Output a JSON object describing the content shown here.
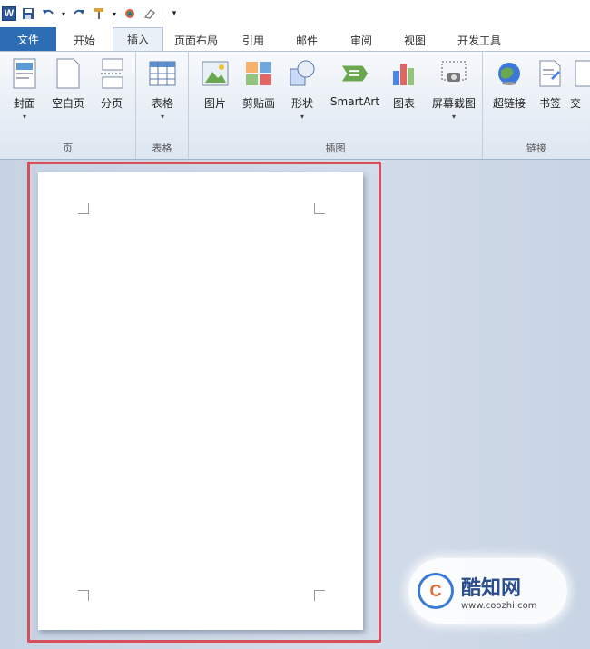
{
  "qat": {
    "app_letter": "W"
  },
  "tabs": [
    {
      "label": "文件"
    },
    {
      "label": "开始"
    },
    {
      "label": "插入"
    },
    {
      "label": "页面布局"
    },
    {
      "label": "引用"
    },
    {
      "label": "邮件"
    },
    {
      "label": "审阅"
    },
    {
      "label": "视图"
    },
    {
      "label": "开发工具"
    }
  ],
  "ribbon": {
    "groups": [
      {
        "label": "页",
        "buttons": [
          {
            "label": "封面"
          },
          {
            "label": "空白页"
          },
          {
            "label": "分页"
          }
        ]
      },
      {
        "label": "表格",
        "buttons": [
          {
            "label": "表格"
          }
        ]
      },
      {
        "label": "插图",
        "buttons": [
          {
            "label": "图片"
          },
          {
            "label": "剪贴画"
          },
          {
            "label": "形状"
          },
          {
            "label": "SmartArt"
          },
          {
            "label": "图表"
          },
          {
            "label": "屏幕截图"
          }
        ]
      },
      {
        "label": "链接",
        "buttons": [
          {
            "label": "超链接"
          },
          {
            "label": "书签"
          },
          {
            "label": "交"
          }
        ]
      }
    ]
  },
  "watermark": {
    "logo": "C",
    "title": "酷知网",
    "url": "www.coozhi.com"
  },
  "colors": {
    "file_tab": "#2d6db4",
    "highlight_border": "#d6505b",
    "doc_background": "#c9d6e6"
  }
}
